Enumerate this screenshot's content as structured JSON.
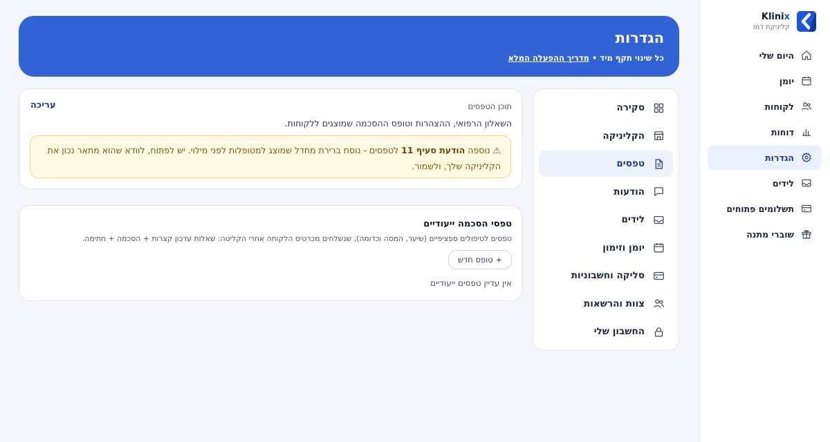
{
  "brand": {
    "name_main": "Klini",
    "name_accent": "x",
    "subtitle": "קליניקת דמו",
    "accent_color": "#1a56db"
  },
  "sidebar": {
    "items": [
      {
        "label": "היום שלי",
        "icon": "home-icon",
        "active": false
      },
      {
        "label": "יומן",
        "icon": "calendar-icon",
        "active": false
      },
      {
        "label": "לקוחות",
        "icon": "users-icon",
        "active": false
      },
      {
        "label": "דוחות",
        "icon": "bar-chart-icon",
        "active": false
      },
      {
        "label": "הגדרות",
        "icon": "gear-icon",
        "active": true
      },
      {
        "label": "לידים",
        "icon": "inbox-icon",
        "active": false
      },
      {
        "label": "תשלומים פתוחים",
        "icon": "credit-card-icon",
        "active": false
      },
      {
        "label": "שוברי מתנה",
        "icon": "gift-icon",
        "active": false
      }
    ]
  },
  "header": {
    "title": "הגדרות",
    "subtitle": "כל שינוי תקף מיד •",
    "guide_link": "מדריך ההפעלה המלא",
    "background_color": "#3263d4"
  },
  "settings_nav": {
    "items": [
      {
        "label": "סקירה",
        "icon": "grid-icon",
        "active": false
      },
      {
        "label": "הקליניקה",
        "icon": "store-icon",
        "active": false
      },
      {
        "label": "טפסים",
        "icon": "document-icon",
        "active": true
      },
      {
        "label": "הודעות",
        "icon": "message-icon",
        "active": false
      },
      {
        "label": "לידים",
        "icon": "inbox-icon",
        "active": false
      },
      {
        "label": "יומן וזימון",
        "icon": "calendar-icon",
        "active": false
      },
      {
        "label": "סליקה וחשבוניות",
        "icon": "credit-card-icon",
        "active": false
      },
      {
        "label": "צוות והרשאות",
        "icon": "users-icon",
        "active": false
      },
      {
        "label": "החשבון שלי",
        "icon": "lock-icon",
        "active": false
      }
    ]
  },
  "forms_content": {
    "label": "תוכן הטפסים",
    "edit": "עריכה",
    "description": "השאלון הרפואי, ההצהרות וטופס ההסכמה שמוצגים ללקוחות.",
    "warning": {
      "icon": "⚠",
      "prefix": "נוספה",
      "bold": "הודעת סעיף 11",
      "text": "לטפסים - נוסח ברירת מחדל שמוצג למטופלות לפני מילוי. יש לפתוח, לוודא שהוא מתאר נכון את הקליניקה שלך, ולשמור.",
      "background_color": "#fef9e3",
      "border_color": "#f1d58a"
    }
  },
  "consent_forms": {
    "title": "טפסי הסכמה ייעודיים",
    "description": "טפסים לטיפולים ספציפיים (שיער, המסה וכדומה), שנשלחים מכרטיס הלקוחה אחרי הקליטה: שאלות עדכון קצרות + הסכמה + חתימה.",
    "new_button": "+ טופס חדש",
    "empty": "אין עדיין טפסים ייעודיים"
  }
}
